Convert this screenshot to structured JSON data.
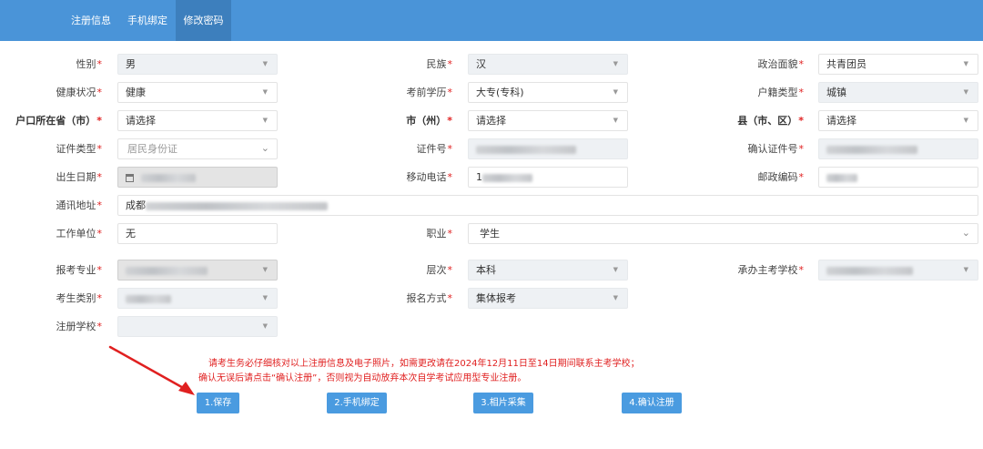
{
  "tabs": [
    {
      "label": "注册信息"
    },
    {
      "label": "手机绑定"
    },
    {
      "label": "修改密码"
    }
  ],
  "fields": {
    "gender": {
      "label": "性别",
      "value": "男"
    },
    "ethnicity": {
      "label": "民族",
      "value": "汉"
    },
    "political": {
      "label": "政治面貌",
      "value": "共青团员"
    },
    "health": {
      "label": "健康状况",
      "value": "健康"
    },
    "education": {
      "label": "考前学历",
      "value": "大专(专科)"
    },
    "hukou_type": {
      "label": "户籍类型",
      "value": "城镇"
    },
    "province": {
      "label": "户口所在省（市）",
      "value": "请选择"
    },
    "city": {
      "label": "市（州）",
      "value": "请选择"
    },
    "county": {
      "label": "县（市、区）",
      "value": "请选择"
    },
    "id_type": {
      "label": "证件类型",
      "value": "居民身份证"
    },
    "id_number": {
      "label": "证件号",
      "value": ""
    },
    "id_confirm": {
      "label": "确认证件号",
      "value": ""
    },
    "birthdate": {
      "label": "出生日期",
      "value": ""
    },
    "mobile": {
      "label": "移动电话",
      "value": "1"
    },
    "postcode": {
      "label": "邮政编码",
      "value": ""
    },
    "address": {
      "label": "通讯地址",
      "value": "成都"
    },
    "employer": {
      "label": "工作单位",
      "value": "无"
    },
    "occupation": {
      "label": "职业",
      "value": "学生"
    },
    "major": {
      "label": "报考专业",
      "value": ""
    },
    "level": {
      "label": "层次",
      "value": "本科"
    },
    "host_school": {
      "label": "承办主考学校",
      "value": ""
    },
    "candidate_type": {
      "label": "考生类别",
      "value": ""
    },
    "reg_method": {
      "label": "报名方式",
      "value": "集体报考"
    },
    "reg_school": {
      "label": "注册学校",
      "value": ""
    }
  },
  "notice": {
    "line1": "请考生务必仔细核对以上注册信息及电子照片，如需更改请在2024年12月11日至14日期间联系主考学校；",
    "line2": "确认无误后请点击“确认注册”，否则视为自动放弃本次自学考试应用型专业注册。"
  },
  "buttons": {
    "save": "1.保存",
    "bind_phone": "2.手机绑定",
    "photo": "3.相片采集",
    "confirm": "4.确认注册"
  },
  "required_mark": "*",
  "colors": {
    "topbar": "#4a94d8",
    "active_tab": "#3d7fbd",
    "button": "#4a9be0",
    "required": "#e02020",
    "notice": "#e02020"
  }
}
